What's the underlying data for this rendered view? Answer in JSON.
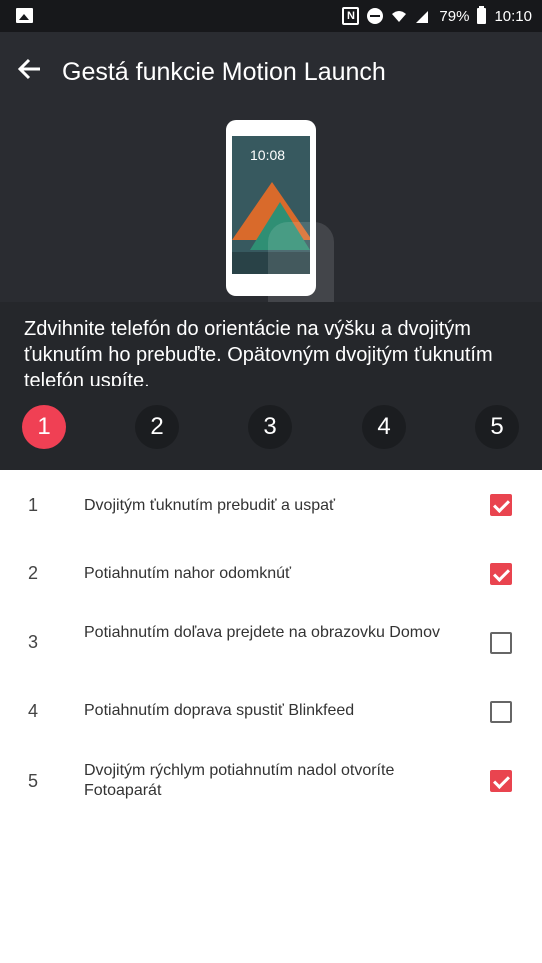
{
  "status_bar": {
    "battery": "79%",
    "time": "10:10"
  },
  "header": {
    "title": "Gestá funkcie Motion Launch"
  },
  "phone_preview": {
    "clock": "10:08"
  },
  "description": "Zdvihnite telefón do orientácie na výšku a dvojitým ťuknutím ho prebuďte. Opätovným dvojitým ťuknutím telefón uspíte.",
  "steps": [
    "1",
    "2",
    "3",
    "4",
    "5"
  ],
  "gestures": [
    {
      "num": "1",
      "label": "Dvojitým ťuknutím prebudiť a uspať",
      "checked": true
    },
    {
      "num": "2",
      "label": "Potiahnutím nahor odomknúť",
      "checked": true
    },
    {
      "num": "3",
      "label": "Potiahnutím doľava prejdete na obrazovku Domov",
      "checked": false
    },
    {
      "num": "4",
      "label": "Potiahnutím doprava spustiť Blinkfeed",
      "checked": false
    },
    {
      "num": "5",
      "label": "Dvojitým rýchlym potiahnutím nadol otvoríte Fotoaparát",
      "checked": true
    }
  ],
  "colors": {
    "accent": "#e9444f",
    "header_bg": "#2a2c31",
    "content_bg": "#25272b"
  }
}
